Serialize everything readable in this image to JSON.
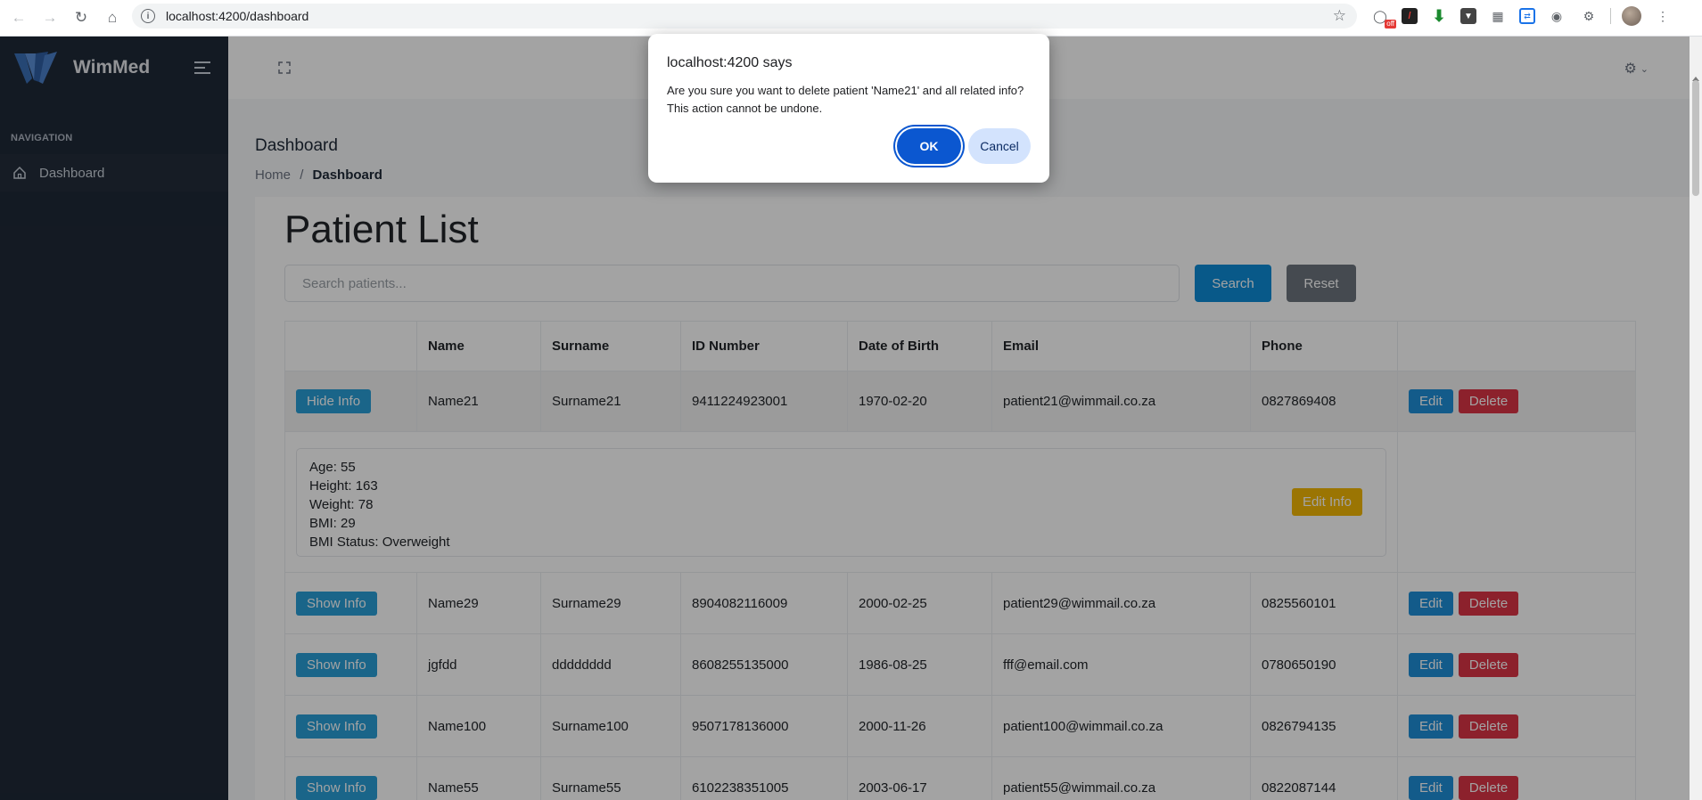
{
  "browser": {
    "url": "localhost:4200/dashboard",
    "extension_badge": "off"
  },
  "app": {
    "brand": "WimMed",
    "nav_caption": "NAVIGATION",
    "nav_items": [
      {
        "label": "Dashboard",
        "icon": "home-icon"
      }
    ],
    "page_title": "Dashboard",
    "breadcrumb": {
      "home": "Home",
      "separator": "/",
      "current": "Dashboard"
    }
  },
  "patients": {
    "title": "Patient List",
    "search_placeholder": "Search patients...",
    "search_label": "Search",
    "reset_label": "Reset",
    "columns": [
      "",
      "Name",
      "Surname",
      "ID Number",
      "Date of Birth",
      "Email",
      "Phone",
      ""
    ],
    "edit_label": "Edit",
    "delete_label": "Delete",
    "rows": [
      {
        "toggle": "Hide Info",
        "name": "Name21",
        "surname": "Surname21",
        "id": "9411224923001",
        "dob": "1970-02-20",
        "email": "patient21@wimmail.co.za",
        "phone": "0827869408"
      },
      {
        "toggle": "Show Info",
        "name": "Name29",
        "surname": "Surname29",
        "id": "8904082116009",
        "dob": "2000-02-25",
        "email": "patient29@wimmail.co.za",
        "phone": "0825560101"
      },
      {
        "toggle": "Show Info",
        "name": "jgfdd",
        "surname": "dddddddd",
        "id": "8608255135000",
        "dob": "1986-08-25",
        "email": "fff@email.com",
        "phone": "0780650190"
      },
      {
        "toggle": "Show Info",
        "name": "Name100",
        "surname": "Surname100",
        "id": "9507178136000",
        "dob": "2000-11-26",
        "email": "patient100@wimmail.co.za",
        "phone": "0826794135"
      },
      {
        "toggle": "Show Info",
        "name": "Name55",
        "surname": "Surname55",
        "id": "6102238351005",
        "dob": "2003-06-17",
        "email": "patient55@wimmail.co.za",
        "phone": "0822087144"
      }
    ],
    "details": {
      "age": "Age: 55",
      "height": "Height: 163",
      "weight": "Weight: 78",
      "bmi": "BMI: 29",
      "bmi_status": "BMI Status: Overweight",
      "edit_info_label": "Edit Info"
    }
  },
  "dialog": {
    "title": "localhost:4200 says",
    "message_line1": "Are you sure you want to delete patient 'Name21' and all related info?",
    "message_line2": "This action cannot be undone.",
    "ok_label": "OK",
    "cancel_label": "Cancel"
  },
  "colors": {
    "sidebar": "#1f2937",
    "primary": "#0d8bd6",
    "danger": "#dc3545",
    "warning": "#f2b705",
    "dialog_ok": "#0b57d0"
  }
}
